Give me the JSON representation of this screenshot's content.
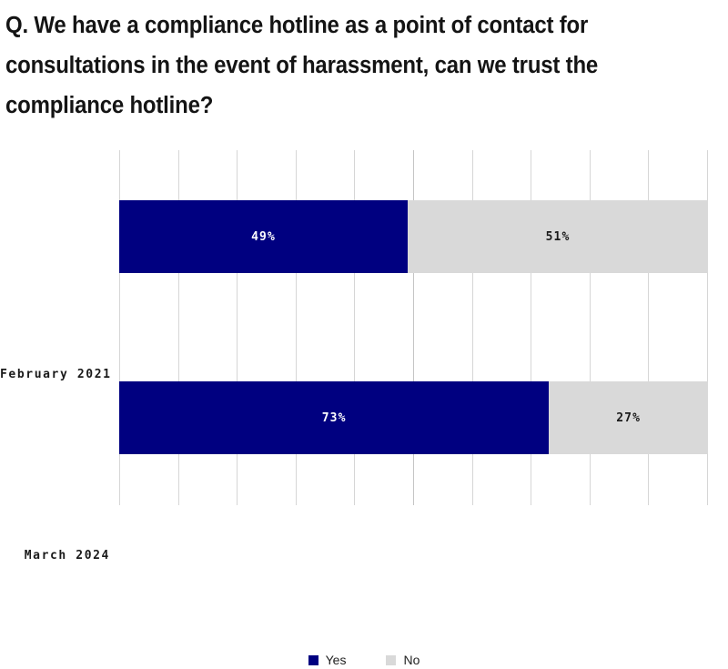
{
  "title": "Q. We have a compliance hotline as a point of contact for consultations in the event of harassment, can we trust the compliance hotline?",
  "colors": {
    "yes": "#000080",
    "no": "#d9d9d9",
    "gridline": "#d6d6d6",
    "background": "#ffffff",
    "title_text": "#141414"
  },
  "legend": {
    "position": "bottom-center",
    "items": [
      {
        "label": "Yes",
        "color": "#000080",
        "swatch": "legend-swatch-yes"
      },
      {
        "label": "No",
        "color": "#d9d9d9",
        "swatch": "legend-swatch-no"
      }
    ]
  },
  "chart_data": {
    "type": "bar",
    "orientation": "horizontal",
    "stacked": true,
    "stacked_100_percent": true,
    "title": "Q. We have a compliance hotline as a point of contact for consultations in the event of harassment, can we trust the compliance hotline?",
    "xlabel": "",
    "ylabel": "",
    "xlim": [
      0,
      100
    ],
    "xticks": [
      0,
      10,
      20,
      30,
      40,
      50,
      60,
      70,
      80,
      90,
      100
    ],
    "xtick_labels": [],
    "grid": true,
    "grid_axis": "x",
    "legend_position": "bottom-center",
    "categories": [
      "February 2021",
      "March 2024"
    ],
    "series": [
      {
        "name": "Yes",
        "color": "#000080",
        "values": [
          49,
          73
        ],
        "labels": [
          "49%",
          "73%"
        ]
      },
      {
        "name": "No",
        "color": "#d9d9d9",
        "values": [
          51,
          27
        ],
        "labels": [
          "51%",
          "27%"
        ]
      }
    ],
    "rows": [
      {
        "category": "February 2021",
        "segments": [
          {
            "series": "Yes",
            "value": 49,
            "label": "49%"
          },
          {
            "series": "No",
            "value": 51,
            "label": "51%"
          }
        ]
      },
      {
        "category": "March 2024",
        "segments": [
          {
            "series": "Yes",
            "value": 73,
            "label": "73%"
          },
          {
            "series": "No",
            "value": 27,
            "label": "27%"
          }
        ]
      }
    ]
  }
}
